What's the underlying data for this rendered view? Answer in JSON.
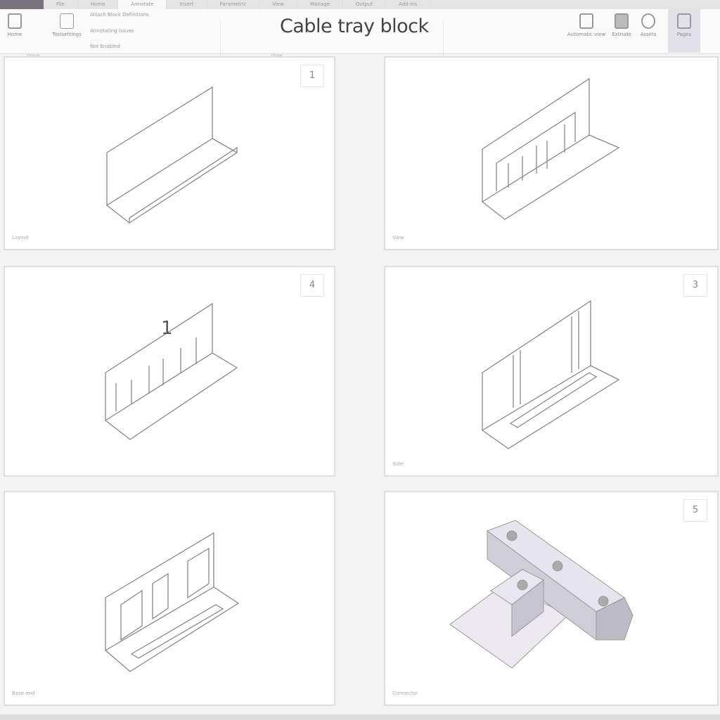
{
  "tabs": [
    "File",
    "Home",
    "Annotate",
    "Insert",
    "Parametric",
    "View",
    "Manage",
    "Output",
    "Add-ins"
  ],
  "ribbon": {
    "buttons": [
      "Home",
      "Toolsettings"
    ],
    "checks": [
      "Attach Block Definitions",
      "Annotating issues",
      "Not Enabled"
    ],
    "groups": [
      "Group",
      "Draw"
    ],
    "right_buttons": [
      "Automatic view",
      "Extrude",
      "Assets",
      "Pages"
    ]
  },
  "title": "Cable tray block",
  "panels": [
    {
      "number": "1",
      "footer": "Layout"
    },
    {
      "number": "",
      "footer": "View"
    },
    {
      "number": "4",
      "footer": "",
      "annotation": "1"
    },
    {
      "number": "3",
      "footer": "Side"
    },
    {
      "number": "",
      "footer": "Base end"
    },
    {
      "number": "5",
      "footer": "Connector"
    }
  ]
}
